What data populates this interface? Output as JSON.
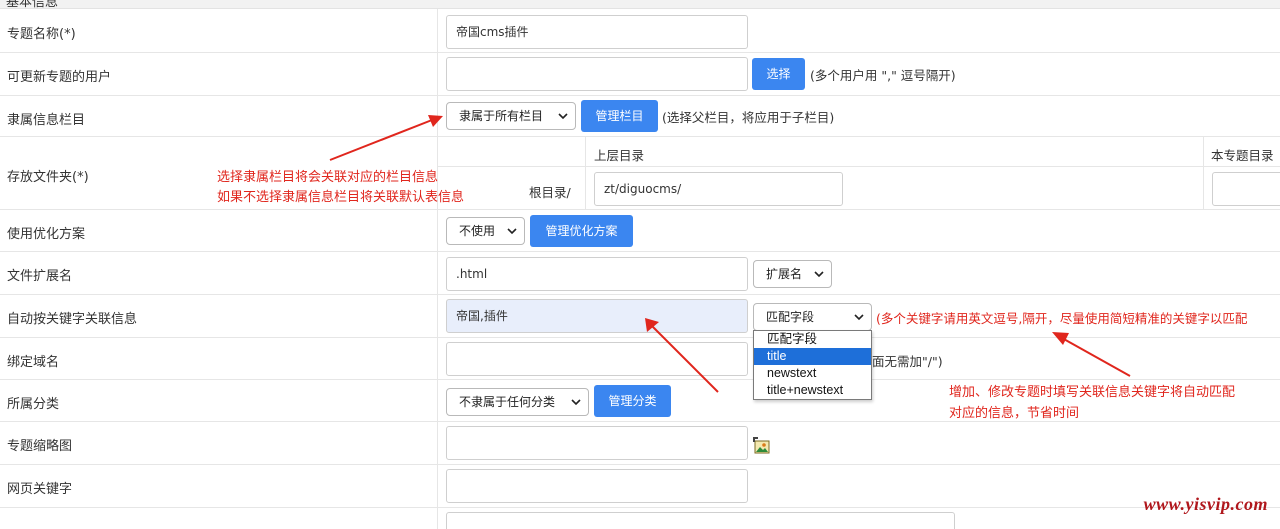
{
  "section_title": "基本信息",
  "rows": [
    {
      "label": "专题名称(*)"
    },
    {
      "label": "可更新专题的用户"
    },
    {
      "label": "隶属信息栏目"
    },
    {
      "label": "存放文件夹(*)"
    },
    {
      "label": "使用优化方案"
    },
    {
      "label": "文件扩展名"
    },
    {
      "label": "自动按关键字关联信息"
    },
    {
      "label": "绑定域名"
    },
    {
      "label": "所属分类"
    },
    {
      "label": "专题缩略图"
    },
    {
      "label": "网页关键字"
    }
  ],
  "fields": {
    "topic_name": "帝国cms插件",
    "users": "",
    "choose_button": "选择",
    "users_hint": "(多个用户用 \",\" 逗号隔开)",
    "column_select": "隶属于所有栏目",
    "manage_column_button": "管理栏目",
    "column_hint": "(选择父栏目，将应用于子栏目)",
    "folder_head_parent": "上层目录",
    "folder_head_this": "本专题目录",
    "root_label": "根目录/",
    "parent_dir": "zt/diguocms/",
    "this_dir": "",
    "optimize_select": "不使用",
    "manage_optimize_button": "管理优化方案",
    "extension": ".html",
    "extension_select": "扩展名",
    "keywords": "帝国,插件",
    "match_select": "匹配字段",
    "keywords_hint": "(多个关键字请用英文逗号,隔开，尽量使用简短精准的关键字以匹配",
    "match_options": [
      "匹配字段",
      "title",
      "newstext",
      "title+newstext"
    ],
    "match_selected_index": 1,
    "domain": "",
    "domain_hint": "面无需加\"/\")",
    "category_select": "不隶属于任何分类",
    "manage_category_button": "管理分类",
    "thumbnail": "",
    "page_keywords": ""
  },
  "annotations": {
    "note1_line1": "选择隶属栏目将会关联对应的栏目信息",
    "note1_line2": "如果不选择隶属信息栏目将关联默认表信息",
    "note2_line1": "增加、修改专题时填写关联信息关键字将自动匹配",
    "note2_line2": "对应的信息，节省时间"
  },
  "watermark": "www.yisvip.com",
  "colors": {
    "button": "#3b86f0",
    "annotation": "#e0261d",
    "watermark": "#b0171c",
    "selected_option": "#1e6fd9"
  },
  "icons": {
    "caret": "chevron-down-icon",
    "picture": "image-picker-icon"
  }
}
